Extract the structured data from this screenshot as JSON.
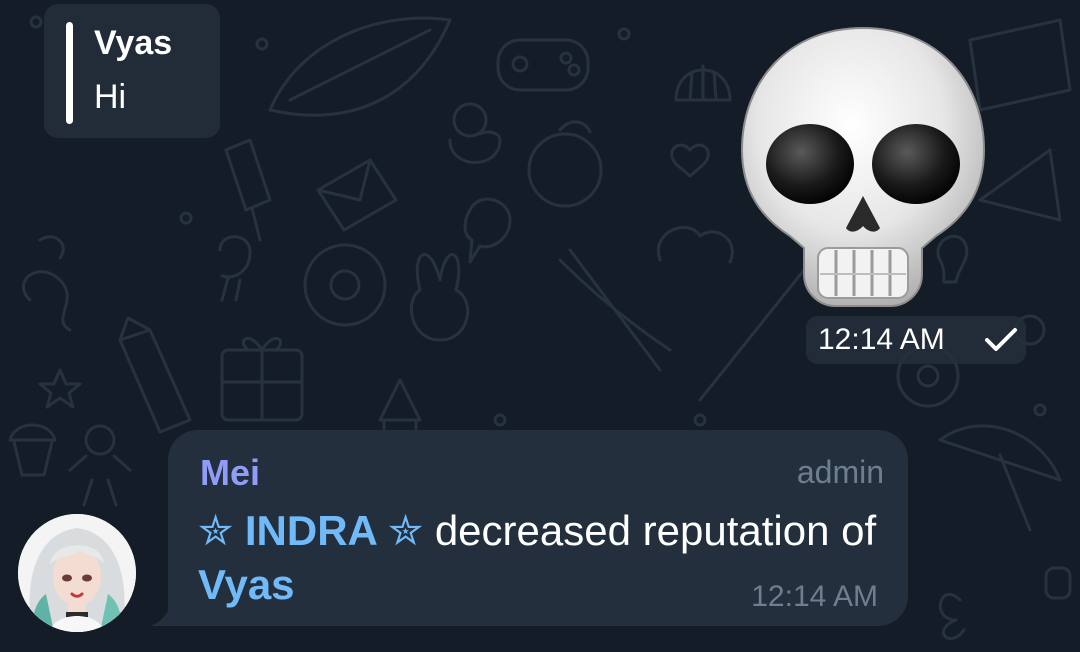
{
  "reply_preview": {
    "name": "Vyas",
    "text": "Hi"
  },
  "sticker": {
    "emoji_name": "skull-sticker",
    "time": "12:14 AM",
    "status_icon": "check-icon"
  },
  "message": {
    "sender": "Mei",
    "role": "admin",
    "mention_1": "✮ INDRA ✮",
    "body_mid": " decreased reputation of ",
    "mention_2": "Vyas",
    "time": "12:14 AM",
    "avatar_icon": "avatar"
  },
  "colors": {
    "background": "#141d27",
    "bubble": "#242f3d",
    "sender_name": "#8f9cf8",
    "mention": "#71baf9",
    "meta_text": "#6d7f8f"
  }
}
